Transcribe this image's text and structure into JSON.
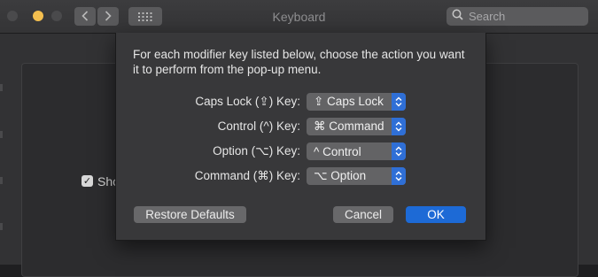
{
  "window": {
    "title": "Keyboard"
  },
  "search": {
    "placeholder": "Search"
  },
  "background": {
    "checkbox_label": "Sho"
  },
  "sheet": {
    "prompt": "For each modifier key listed below, choose the action you want it to perform from the pop-up menu.",
    "rows": [
      {
        "label": "Caps Lock (⇪) Key:",
        "value": "⇪ Caps Lock"
      },
      {
        "label": "Control (^) Key:",
        "value": "⌘ Command"
      },
      {
        "label": "Option (⌥) Key:",
        "value": "^ Control"
      },
      {
        "label": "Command (⌘) Key:",
        "value": "⌥ Option"
      }
    ],
    "buttons": {
      "restore": "Restore Defaults",
      "cancel": "Cancel",
      "ok": "OK"
    }
  },
  "colors": {
    "accent": "#1d6ad6",
    "popup_arrow": "#2f6fd6",
    "sheet_bg": "#38383a"
  },
  "icons": [
    "back-chevron-icon",
    "forward-chevron-icon",
    "grid-icon",
    "search-icon",
    "updown-arrows-icon",
    "checkmark-icon"
  ]
}
